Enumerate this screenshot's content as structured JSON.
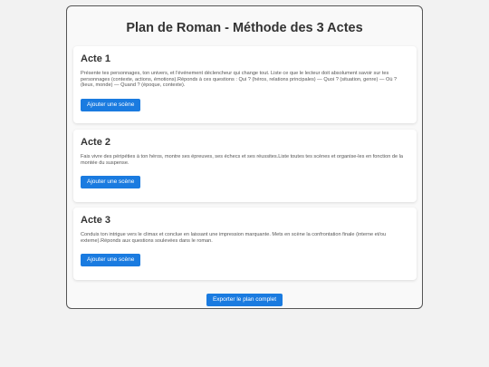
{
  "page_title": "Plan de Roman - Méthode des 3 Actes",
  "acts": [
    {
      "title": "Acte 1",
      "description": "Présente tes personnages, ton univers, et l'événement déclencheur qui change tout. Liste ce que le lecteur doit absolument savoir sur tes personnages (contexte, actions, émotions).Réponds à ces questions : Qui ? (héros, relations principales) — Quoi ? (situation, genre) — Où ? (lieux, monde) — Quand ? (époque, contexte).",
      "button": "Ajouter une scène"
    },
    {
      "title": "Acte 2",
      "description": "Fais vivre des péripéties à ton héros, montre ses épreuves, ses échecs et ses réussites.Liste toutes tes scènes et organise-les en fonction de la montée du suspense.",
      "button": "Ajouter une scène"
    },
    {
      "title": "Acte 3",
      "description": "Conduis ton intrigue vers le climax et conclue en laissant une impression marquante. Mets en scène la confrontation finale (interne et/ou externe).Réponds aux questions soulevées dans le roman.",
      "button": "Ajouter une scène"
    }
  ],
  "export_button": "Exporter le plan complet",
  "colors": {
    "accent": "#1a7be0",
    "background": "#f2f2f2",
    "card": "#ffffff"
  }
}
